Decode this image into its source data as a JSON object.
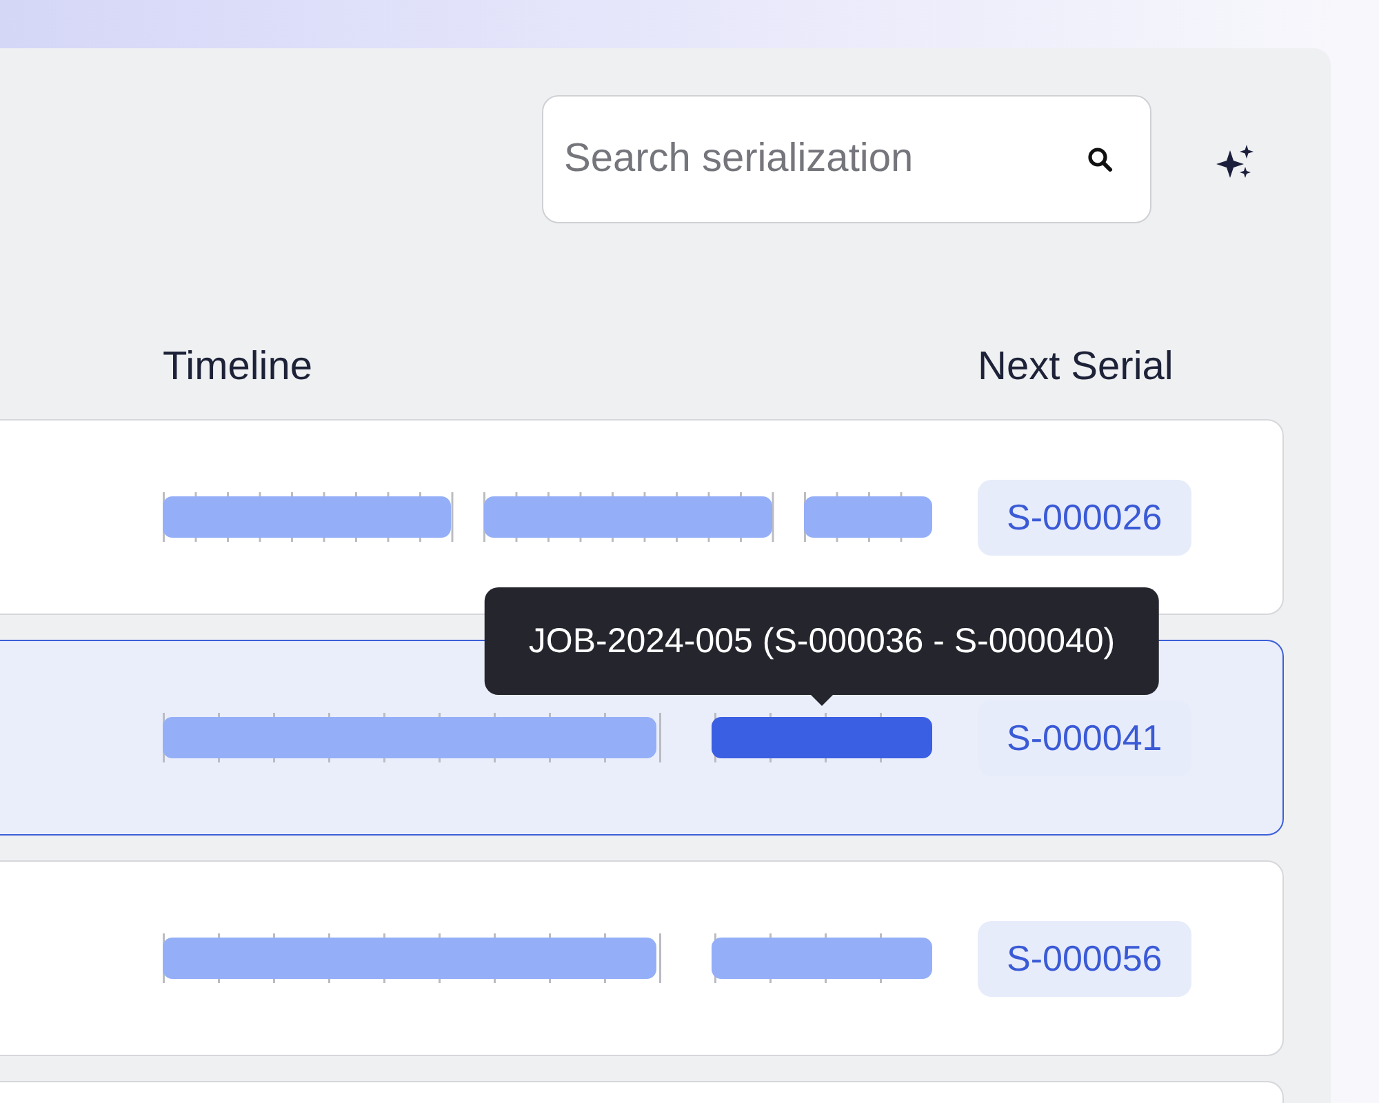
{
  "search": {
    "placeholder": "Search serialization"
  },
  "columns": [
    "Timeline",
    "Next Serial"
  ],
  "rows": [
    {
      "selected": false,
      "next_serial": "S-000026",
      "segments": [
        {
          "selected": false,
          "kind": "medium"
        },
        {
          "selected": false,
          "kind": "medium"
        },
        {
          "selected": false,
          "kind": "stub"
        }
      ]
    },
    {
      "selected": true,
      "next_serial": "S-000041",
      "segments": [
        {
          "selected": false,
          "kind": "long"
        },
        {
          "selected": true,
          "kind": "short"
        }
      ],
      "tooltip": "JOB-2024-005 (S-000036 - S-000040)"
    },
    {
      "selected": false,
      "next_serial": "S-000056",
      "segments": [
        {
          "selected": false,
          "kind": "long"
        },
        {
          "selected": false,
          "kind": "short"
        }
      ]
    },
    {
      "selected": false
    }
  ]
}
